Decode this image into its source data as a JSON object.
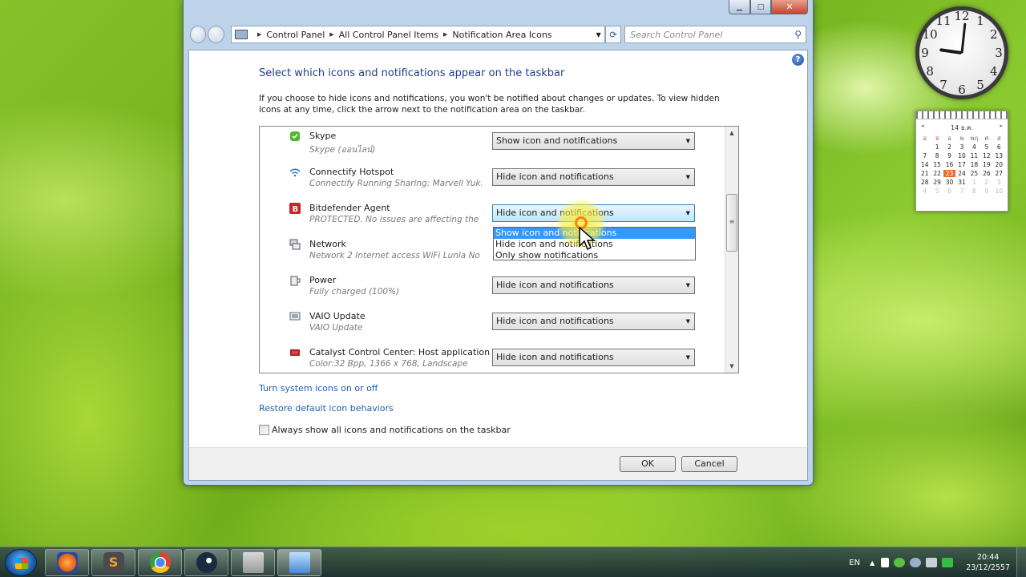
{
  "window": {
    "caption_buttons": {
      "minimize": "▁",
      "maximize": "□",
      "close": "✕"
    },
    "address": [
      "Control Panel",
      "All Control Panel Items",
      "Notification Area Icons"
    ],
    "search_placeholder": "Search Control Panel",
    "help": "?",
    "title": "Select which icons and notifications appear on the taskbar",
    "description": "If you choose to hide icons and notifications, you won't be notified about changes or updates. To view hidden icons at any time, click the arrow next to the notification area on the taskbar.",
    "rows": [
      {
        "name": "Skype",
        "sub": "Skype (ออนไลน์)",
        "behavior": "Show icon and notifications",
        "icon": "skype-icon"
      },
      {
        "name": "Connectify Hotspot",
        "sub": "Connectify Running Sharing: Marvell Yuk...",
        "behavior": "Hide icon and notifications",
        "icon": "wifi-icon"
      },
      {
        "name": "Bitdefender Agent",
        "sub": "PROTECTED. No issues are affecting the ...",
        "behavior": "Hide icon and notifications",
        "icon": "bitdefender-icon"
      },
      {
        "name": "Network",
        "sub": "Network  2 Internet access WiFi Lunla No ...",
        "behavior": "",
        "icon": "network-icon"
      },
      {
        "name": "Power",
        "sub": "Fully charged (100%)",
        "behavior": "Hide icon and notifications",
        "icon": "power-icon"
      },
      {
        "name": "VAIO Update",
        "sub": "VAIO Update",
        "behavior": "Hide icon and notifications",
        "icon": "vaio-update-icon"
      },
      {
        "name": "Catalyst Control Center: Host application",
        "sub": "Color:32 Bpp, 1366 x 768, Landscape",
        "behavior": "Hide icon and notifications",
        "icon": "catalyst-icon"
      }
    ],
    "dropdown_options": [
      "Show icon and notifications",
      "Hide icon and notifications",
      "Only show notifications"
    ],
    "dropdown_selected_index": 0,
    "link_system_icons": "Turn system icons on or off",
    "link_restore": "Restore default icon behaviors",
    "always_show_label": "Always show all icons and notifications on the taskbar",
    "always_show_checked": false,
    "ok": "OK",
    "cancel": "Cancel"
  },
  "clock_gadget": {
    "numbers": [
      "12",
      "1",
      "2",
      "3",
      "4",
      "5",
      "6",
      "7",
      "8",
      "9",
      "10",
      "11"
    ]
  },
  "calendar_gadget": {
    "month": "14 ธ.ค.",
    "prev": "◂",
    "next": "▸",
    "day_headers": [
      "อ",
      "จ",
      "อ",
      "พ",
      "พฤ",
      "ศ",
      "ส"
    ],
    "days": [
      "",
      "1",
      "2",
      "3",
      "4",
      "5",
      "6",
      "7",
      "8",
      "9",
      "10",
      "11",
      "12",
      "13",
      "14",
      "15",
      "16",
      "17",
      "18",
      "19",
      "20",
      "21",
      "22",
      "23",
      "24",
      "25",
      "26",
      "27",
      "28",
      "29",
      "30",
      "31",
      "1",
      "2",
      "3",
      "4",
      "5",
      "6",
      "7",
      "8",
      "9",
      "10"
    ],
    "today": "23"
  },
  "taskbar": {
    "apps": [
      "firefox",
      "sublime-text",
      "chrome",
      "steam",
      "explorer",
      "control-panel"
    ],
    "lang": "EN",
    "time": "20:44",
    "date": "23/12/2557"
  }
}
